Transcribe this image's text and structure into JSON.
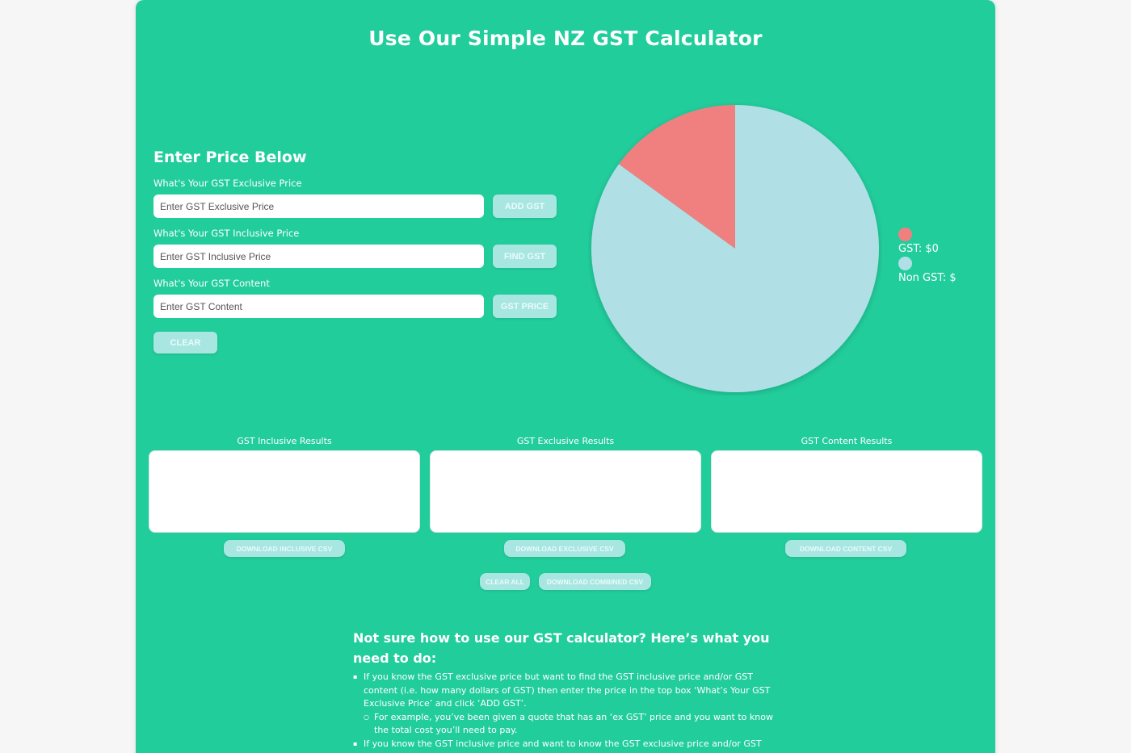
{
  "page": {
    "title": "Use Our Simple NZ GST Calculator",
    "section_title": "Enter Price Below"
  },
  "form": {
    "exclusive": {
      "label": "What's Your GST Exclusive Price",
      "placeholder": "Enter GST Exclusive Price",
      "button": "ADD GST"
    },
    "inclusive": {
      "label": "What's Your GST Inclusive Price",
      "placeholder": "Enter GST Inclusive Price",
      "button": "FIND GST"
    },
    "content": {
      "label": "What's Your GST Content",
      "placeholder": "Enter GST Content",
      "button": "GST PRICE"
    },
    "clear_button": "CLEAR"
  },
  "chart_data": {
    "type": "pie",
    "slices": [
      {
        "label": "GST: $0",
        "fraction": 0.15,
        "color": "#f08080"
      },
      {
        "label": "Non GST: $",
        "fraction": 0.85,
        "color": "#b0e0e6"
      }
    ]
  },
  "results": [
    {
      "label": "GST Inclusive Results",
      "download": "DOWNLOAD INCLUSIVE CSV"
    },
    {
      "label": "GST Exclusive Results",
      "download": "DOWNLOAD EXCLUSIVE CSV"
    },
    {
      "label": "GST Content Results",
      "download": "DOWNLOAD CONTENT CSV"
    }
  ],
  "bulk_actions": {
    "clear_all": "CLEAR ALL",
    "download_combined": "DOWNLOAD COMBINED CSV"
  },
  "help": {
    "title": "Not sure how to use our GST calculator? Here’s what you need to do:",
    "items": [
      "If you know the GST exclusive price but want to find the GST inclusive price and/or GST content (i.e. how many dollars of GST) then enter the price in the top box ‘What’s Your GST Exclusive Price’ and click ‘ADD GST’.",
      "For example, you’ve been given a quote that has an ‘ex GST’ price and you want to know the total cost you’ll need to pay.",
      "If you know the GST inclusive price and want to know the GST exclusive price and/or GST"
    ]
  },
  "colors": {
    "background": "#22cd9c",
    "button": "#a8e6e2",
    "gst_slice": "#f08080",
    "non_gst_slice": "#b0e0e6"
  }
}
